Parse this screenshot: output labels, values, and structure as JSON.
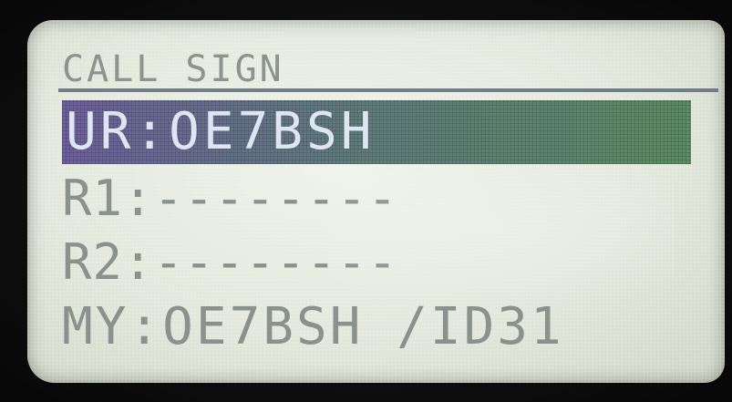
{
  "display": {
    "title": "CALL SIGN",
    "ur_row": "UR:OE7BSH",
    "r1_row": "R1:--------",
    "r2_row": "R2:--------",
    "my_row": "MY:OE7BSH /ID31"
  },
  "colors": {
    "lcd_background": "#e6ebdf",
    "segment_text": "#8b918c",
    "highlight_bar": "#5f7a7c",
    "highlight_text": "#dfe6f2"
  }
}
